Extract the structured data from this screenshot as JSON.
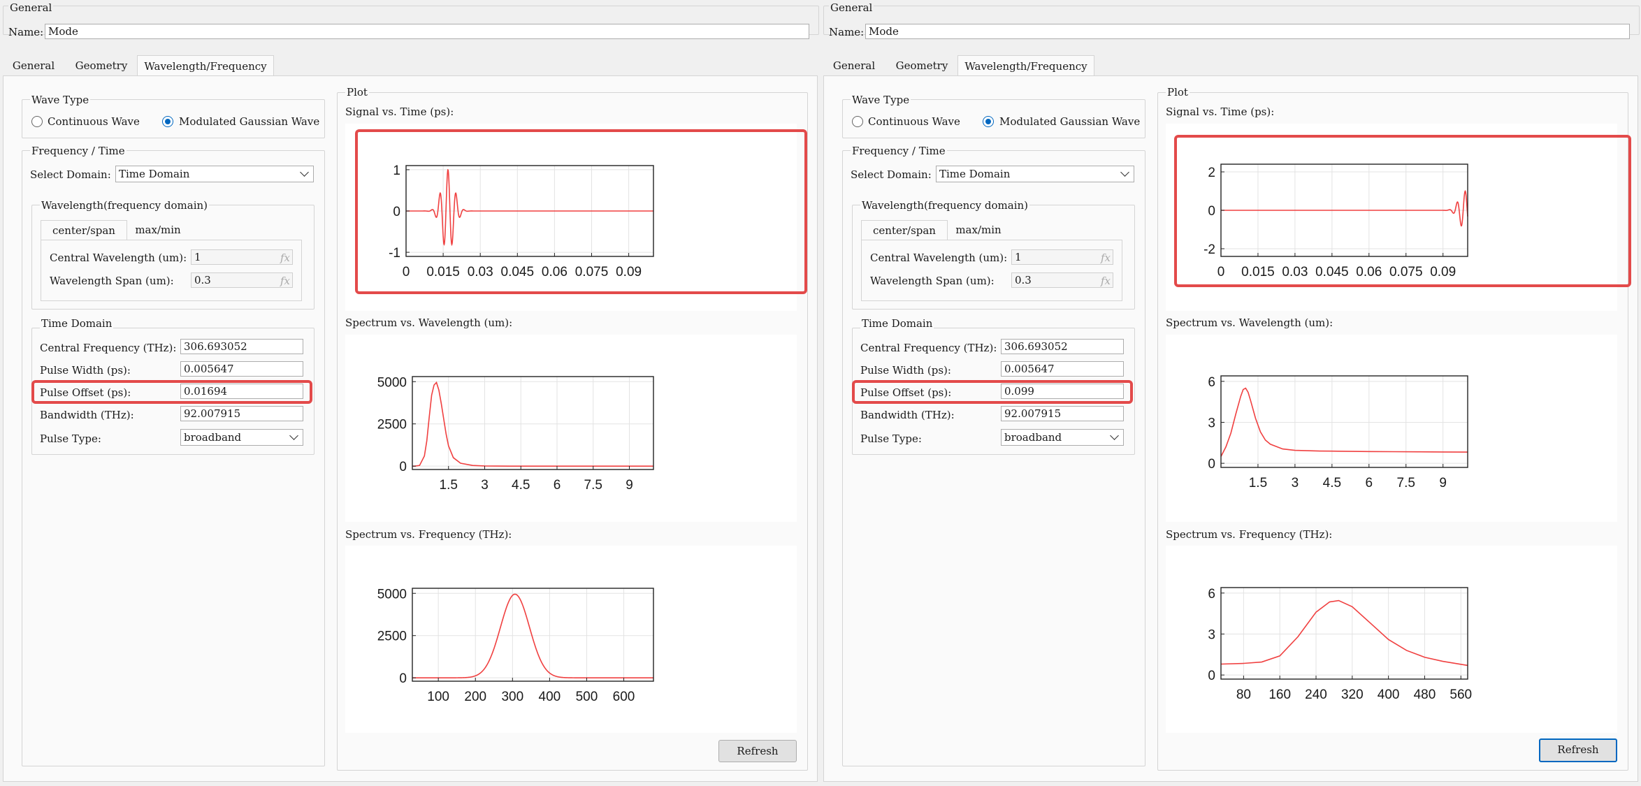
{
  "panels": [
    {
      "general_title": "General",
      "name_label": "Name:",
      "name_value": "Mode",
      "tabs": [
        "General",
        "Geometry",
        "Wavelength/Frequency"
      ],
      "wave_type": {
        "title": "Wave Type",
        "option1": "Continuous Wave",
        "option2": "Modulated Gaussian Wave",
        "selected": "Modulated Gaussian Wave"
      },
      "freq_time": {
        "title": "Frequency / Time",
        "select_label": "Select Domain:",
        "select_value": "Time Domain",
        "wl_group": {
          "title": "Wavelength(frequency domain)",
          "tabs": [
            "center/span",
            "max/min"
          ],
          "central_label": "Central Wavelength (um):",
          "central_value": "1",
          "span_label": "Wavelength Span (um):",
          "span_value": "0.3",
          "fx": "fx"
        },
        "time_group": {
          "title": "Time Domain",
          "cf_label": "Central Frequency (THz):",
          "cf_value": "306.693052",
          "pw_label": "Pulse Width (ps):",
          "pw_value": "0.005647",
          "po_label": "Pulse Offset (ps):",
          "po_value": "0.01694",
          "bw_label": "Bandwidth (THz):",
          "bw_value": "92.007915",
          "pt_label": "Pulse Type:",
          "pt_value": "broadband"
        }
      },
      "plot": {
        "title": "Plot",
        "signal_title": "Signal vs. Time (ps):",
        "spectrum_wl_title": "Spectrum vs. Wavelength (um):",
        "spectrum_f_title": "Spectrum vs. Frequency (THz):",
        "refresh": "Refresh"
      }
    },
    {
      "general_title": "General",
      "name_label": "Name:",
      "name_value": "Mode",
      "tabs": [
        "General",
        "Geometry",
        "Wavelength/Frequency"
      ],
      "wave_type": {
        "title": "Wave Type",
        "option1": "Continuous Wave",
        "option2": "Modulated Gaussian Wave",
        "selected": "Modulated Gaussian Wave"
      },
      "freq_time": {
        "title": "Frequency / Time",
        "select_label": "Select Domain:",
        "select_value": "Time Domain",
        "wl_group": {
          "title": "Wavelength(frequency domain)",
          "tabs": [
            "center/span",
            "max/min"
          ],
          "central_label": "Central Wavelength (um):",
          "central_value": "1",
          "span_label": "Wavelength Span (um):",
          "span_value": "0.3",
          "fx": "fx"
        },
        "time_group": {
          "title": "Time Domain",
          "cf_label": "Central Frequency (THz):",
          "cf_value": "306.693052",
          "pw_label": "Pulse Width (ps):",
          "pw_value": "0.005647",
          "po_label": "Pulse Offset (ps):",
          "po_value": "0.099",
          "bw_label": "Bandwidth (THz):",
          "bw_value": "92.007915",
          "pt_label": "Pulse Type:",
          "pt_value": "broadband"
        }
      },
      "plot": {
        "title": "Plot",
        "signal_title": "Signal vs. Time (ps):",
        "spectrum_wl_title": "Spectrum vs. Wavelength (um):",
        "spectrum_f_title": "Spectrum vs. Frequency (THz):",
        "refresh": "Refresh"
      }
    }
  ],
  "colors": {
    "curve": "#f04040",
    "highlight": "#e34a4a",
    "accent": "#0067c0"
  },
  "chart_data": [
    {
      "panel": 0,
      "type": "line",
      "title": "Signal vs. Time (ps):",
      "xlim": [
        0,
        0.1
      ],
      "ylim": [
        -1.1,
        1.1
      ],
      "xticks": [
        0,
        0.015,
        0.03,
        0.045,
        0.06,
        0.075,
        0.09
      ],
      "yticks": [
        -1,
        0,
        1
      ],
      "grid": true,
      "series": [
        {
          "kind": "gaussian_pulse",
          "offset": 0.01694,
          "width": 0.005647,
          "period": 0.00326,
          "amplitude": 1
        }
      ]
    },
    {
      "panel": 0,
      "type": "line",
      "title": "Spectrum vs. Wavelength (um):",
      "xlim": [
        0,
        10
      ],
      "ylim": [
        -200,
        5300
      ],
      "xticks": [
        1.5,
        3,
        4.5,
        6,
        7.5,
        9
      ],
      "yticks": [
        0,
        2500,
        5000
      ],
      "grid": true,
      "series": [
        {
          "x": [
            0,
            0.1,
            0.3,
            0.5,
            0.6,
            0.7,
            0.8,
            0.9,
            1.0,
            1.1,
            1.2,
            1.3,
            1.4,
            1.5,
            1.7,
            2.0,
            2.5,
            3,
            4,
            5,
            7,
            10
          ],
          "y": [
            0,
            0,
            40,
            600,
            1500,
            2900,
            4200,
            4800,
            4950,
            4500,
            3700,
            2800,
            1900,
            1200,
            500,
            170,
            40,
            10,
            0,
            0,
            0,
            0
          ]
        }
      ]
    },
    {
      "panel": 0,
      "type": "line",
      "title": "Spectrum vs. Frequency (THz):",
      "xlim": [
        30,
        680
      ],
      "ylim": [
        -200,
        5300
      ],
      "xticks": [
        100,
        200,
        300,
        400,
        500,
        600
      ],
      "yticks": [
        0,
        2500,
        5000
      ],
      "grid": true,
      "series": [
        {
          "kind": "gaussian_spectrum",
          "center": 306.69,
          "fwhm": 92.0,
          "amplitude": 4950,
          "floor": 0
        }
      ]
    },
    {
      "panel": 1,
      "type": "line",
      "title": "Signal vs. Time (ps):",
      "xlim": [
        0,
        0.1
      ],
      "ylim": [
        -2.4,
        2.4
      ],
      "xticks": [
        0,
        0.015,
        0.03,
        0.045,
        0.06,
        0.075,
        0.09
      ],
      "yticks": [
        -2,
        0,
        2
      ],
      "grid": true,
      "series": [
        {
          "kind": "gaussian_pulse",
          "offset": 0.099,
          "width": 0.005647,
          "period": 0.00326,
          "amplitude": 1
        }
      ]
    },
    {
      "panel": 1,
      "type": "line",
      "title": "Spectrum vs. Wavelength (um):",
      "xlim": [
        0,
        10
      ],
      "ylim": [
        -0.3,
        6.4
      ],
      "xticks": [
        1.5,
        3,
        4.5,
        6,
        7.5,
        9
      ],
      "yticks": [
        0,
        3,
        6
      ],
      "grid": true,
      "series": [
        {
          "x": [
            0,
            0.2,
            0.4,
            0.6,
            0.8,
            0.9,
            1.0,
            1.1,
            1.2,
            1.4,
            1.6,
            1.8,
            2.0,
            2.5,
            3,
            4,
            5,
            6,
            7,
            8,
            9,
            10
          ],
          "y": [
            0.5,
            1.2,
            2.2,
            3.6,
            4.9,
            5.4,
            5.5,
            5.2,
            4.6,
            3.3,
            2.3,
            1.7,
            1.4,
            1.05,
            0.95,
            0.9,
            0.88,
            0.86,
            0.85,
            0.84,
            0.83,
            0.82
          ]
        }
      ]
    },
    {
      "panel": 1,
      "type": "line",
      "title": "Spectrum vs. Frequency (THz):",
      "xlim": [
        30,
        575
      ],
      "ylim": [
        -0.3,
        6.4
      ],
      "xticks": [
        80,
        160,
        240,
        320,
        400,
        480,
        560
      ],
      "yticks": [
        0,
        3,
        6
      ],
      "grid": true,
      "series": [
        {
          "x": [
            30,
            80,
            120,
            160,
            200,
            240,
            270,
            290,
            320,
            360,
            400,
            440,
            480,
            520,
            575
          ],
          "y": [
            0.8,
            0.85,
            0.95,
            1.4,
            2.8,
            4.6,
            5.35,
            5.45,
            5.0,
            3.8,
            2.6,
            1.8,
            1.3,
            1.0,
            0.7
          ]
        }
      ]
    }
  ]
}
